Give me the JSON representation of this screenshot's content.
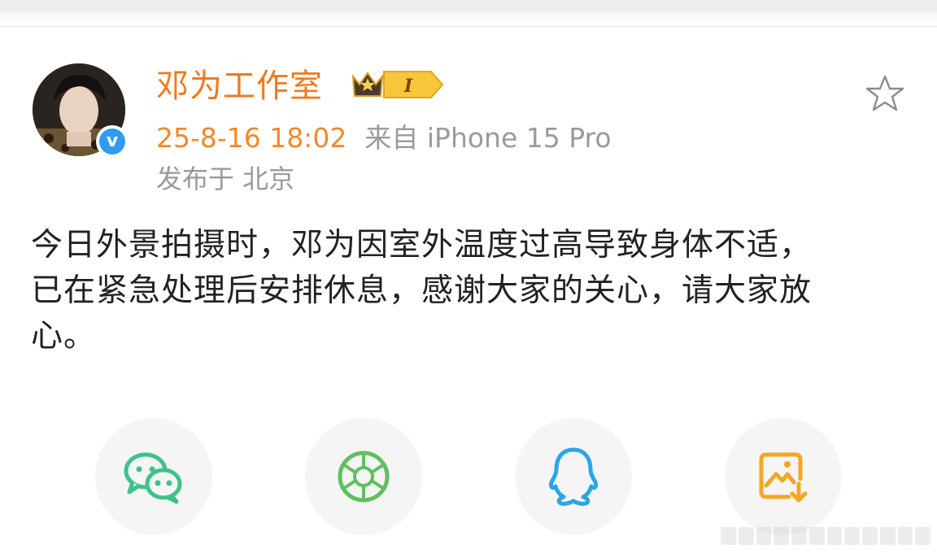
{
  "post": {
    "author_name": "邓为工作室",
    "member_badge_label": "I",
    "verified_mark": "v",
    "time": "25-8-16 18:02",
    "source": "来自 iPhone 15 Pro",
    "location": "发布于 北京",
    "content_lines": [
      "今日外景拍摄时，邓为因室外温度过高导致身体不适，",
      "已在紧急处理后安排休息，感谢大家的关心，请大家放",
      "心。"
    ]
  },
  "share": {
    "items": [
      {
        "icon": "wechat-icon",
        "color": "#3ec28a"
      },
      {
        "icon": "moments-icon",
        "color": "#5fc05e"
      },
      {
        "icon": "qq-icon",
        "color": "#2aa5e8"
      },
      {
        "icon": "save-image-icon",
        "color": "#f5a623"
      }
    ]
  },
  "colors": {
    "author": "#f07a1f",
    "time": "#f08a2a",
    "meta": "#9a9a9a",
    "text": "#222222",
    "verified": "#2f9cf0"
  }
}
